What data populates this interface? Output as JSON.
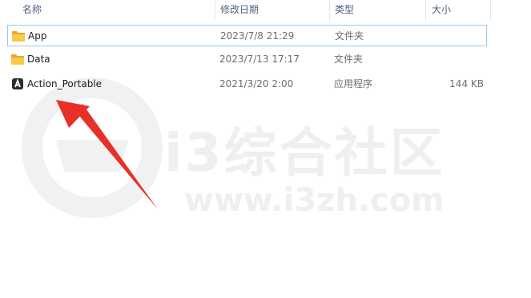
{
  "columns": {
    "name": "名称",
    "date": "修改日期",
    "type": "类型",
    "size": "大小"
  },
  "files": [
    {
      "name": "App",
      "date": "2023/7/8 21:29",
      "type": "文件夹",
      "size": "",
      "icon": "folder-icon"
    },
    {
      "name": "Data",
      "date": "2023/7/13 17:17",
      "type": "文件夹",
      "size": "",
      "icon": "folder-icon"
    },
    {
      "name": "Action_Portable",
      "date": "2021/3/20 2:00",
      "type": "应用程序",
      "size": "144 KB",
      "icon": "app-icon"
    }
  ],
  "watermark": {
    "title": "i3综合社区",
    "url": "www.i3zh.com"
  },
  "colors": {
    "header_text": "#4c607a",
    "selection_border": "#99c9ef",
    "folder": "#f8c94a",
    "arrow": "#e8302a"
  }
}
